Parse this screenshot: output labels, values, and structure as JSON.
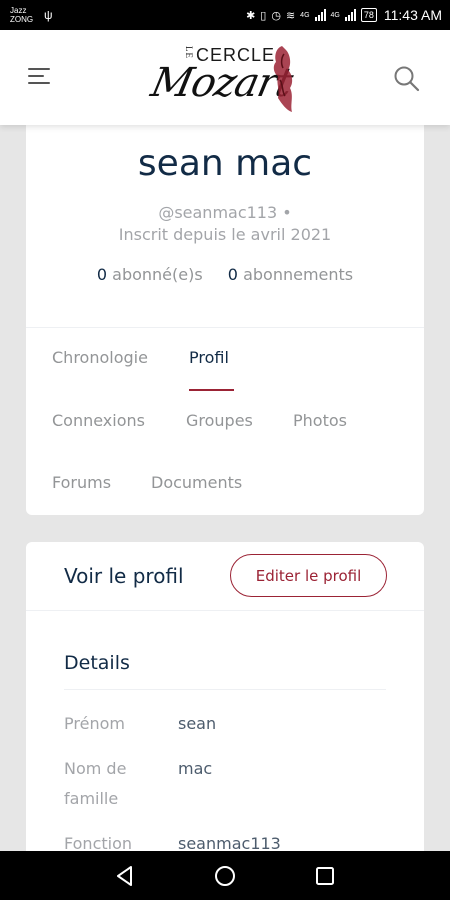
{
  "status_bar": {
    "carrier_line1": "Jazz",
    "carrier_line2": "ZONG",
    "usb_icon": "usb-icon",
    "network_1": "4G",
    "network_2": "4G",
    "battery": "78",
    "time": "11:43 AM"
  },
  "header": {
    "logo_le": "LE",
    "logo_cercle": "CERCLE",
    "logo_mozart": "Mozart",
    "menu_icon": "hamburger-menu-icon",
    "search_icon": "search-icon",
    "accent_color": "#9b2335"
  },
  "profile": {
    "name": "sean mac",
    "handle": "@seanmac113 •",
    "since": "Inscrit depuis le avril 2021",
    "followers_count": "0",
    "followers_label": "abonné(e)s",
    "following_count": "0",
    "following_label": "abonnements",
    "tabs": [
      {
        "label": "Chronologie",
        "active": false
      },
      {
        "label": "Profil",
        "active": true
      },
      {
        "label": "Connexions",
        "active": false
      },
      {
        "label": "Groupes",
        "active": false
      },
      {
        "label": "Photos",
        "active": false
      },
      {
        "label": "Forums",
        "active": false
      },
      {
        "label": "Documents",
        "active": false
      }
    ]
  },
  "details": {
    "title": "Voir le profil",
    "edit_button": "Editer le profil",
    "section_title": "Details",
    "fields": [
      {
        "label": "Prénom",
        "value": "sean"
      },
      {
        "label": "Nom de famille",
        "value": "mac"
      },
      {
        "label": "Fonction",
        "value": "seanmac113"
      }
    ]
  },
  "android_nav": {
    "back_icon": "back-triangle-icon",
    "home_icon": "home-circle-icon",
    "recents_icon": "recents-square-icon"
  }
}
